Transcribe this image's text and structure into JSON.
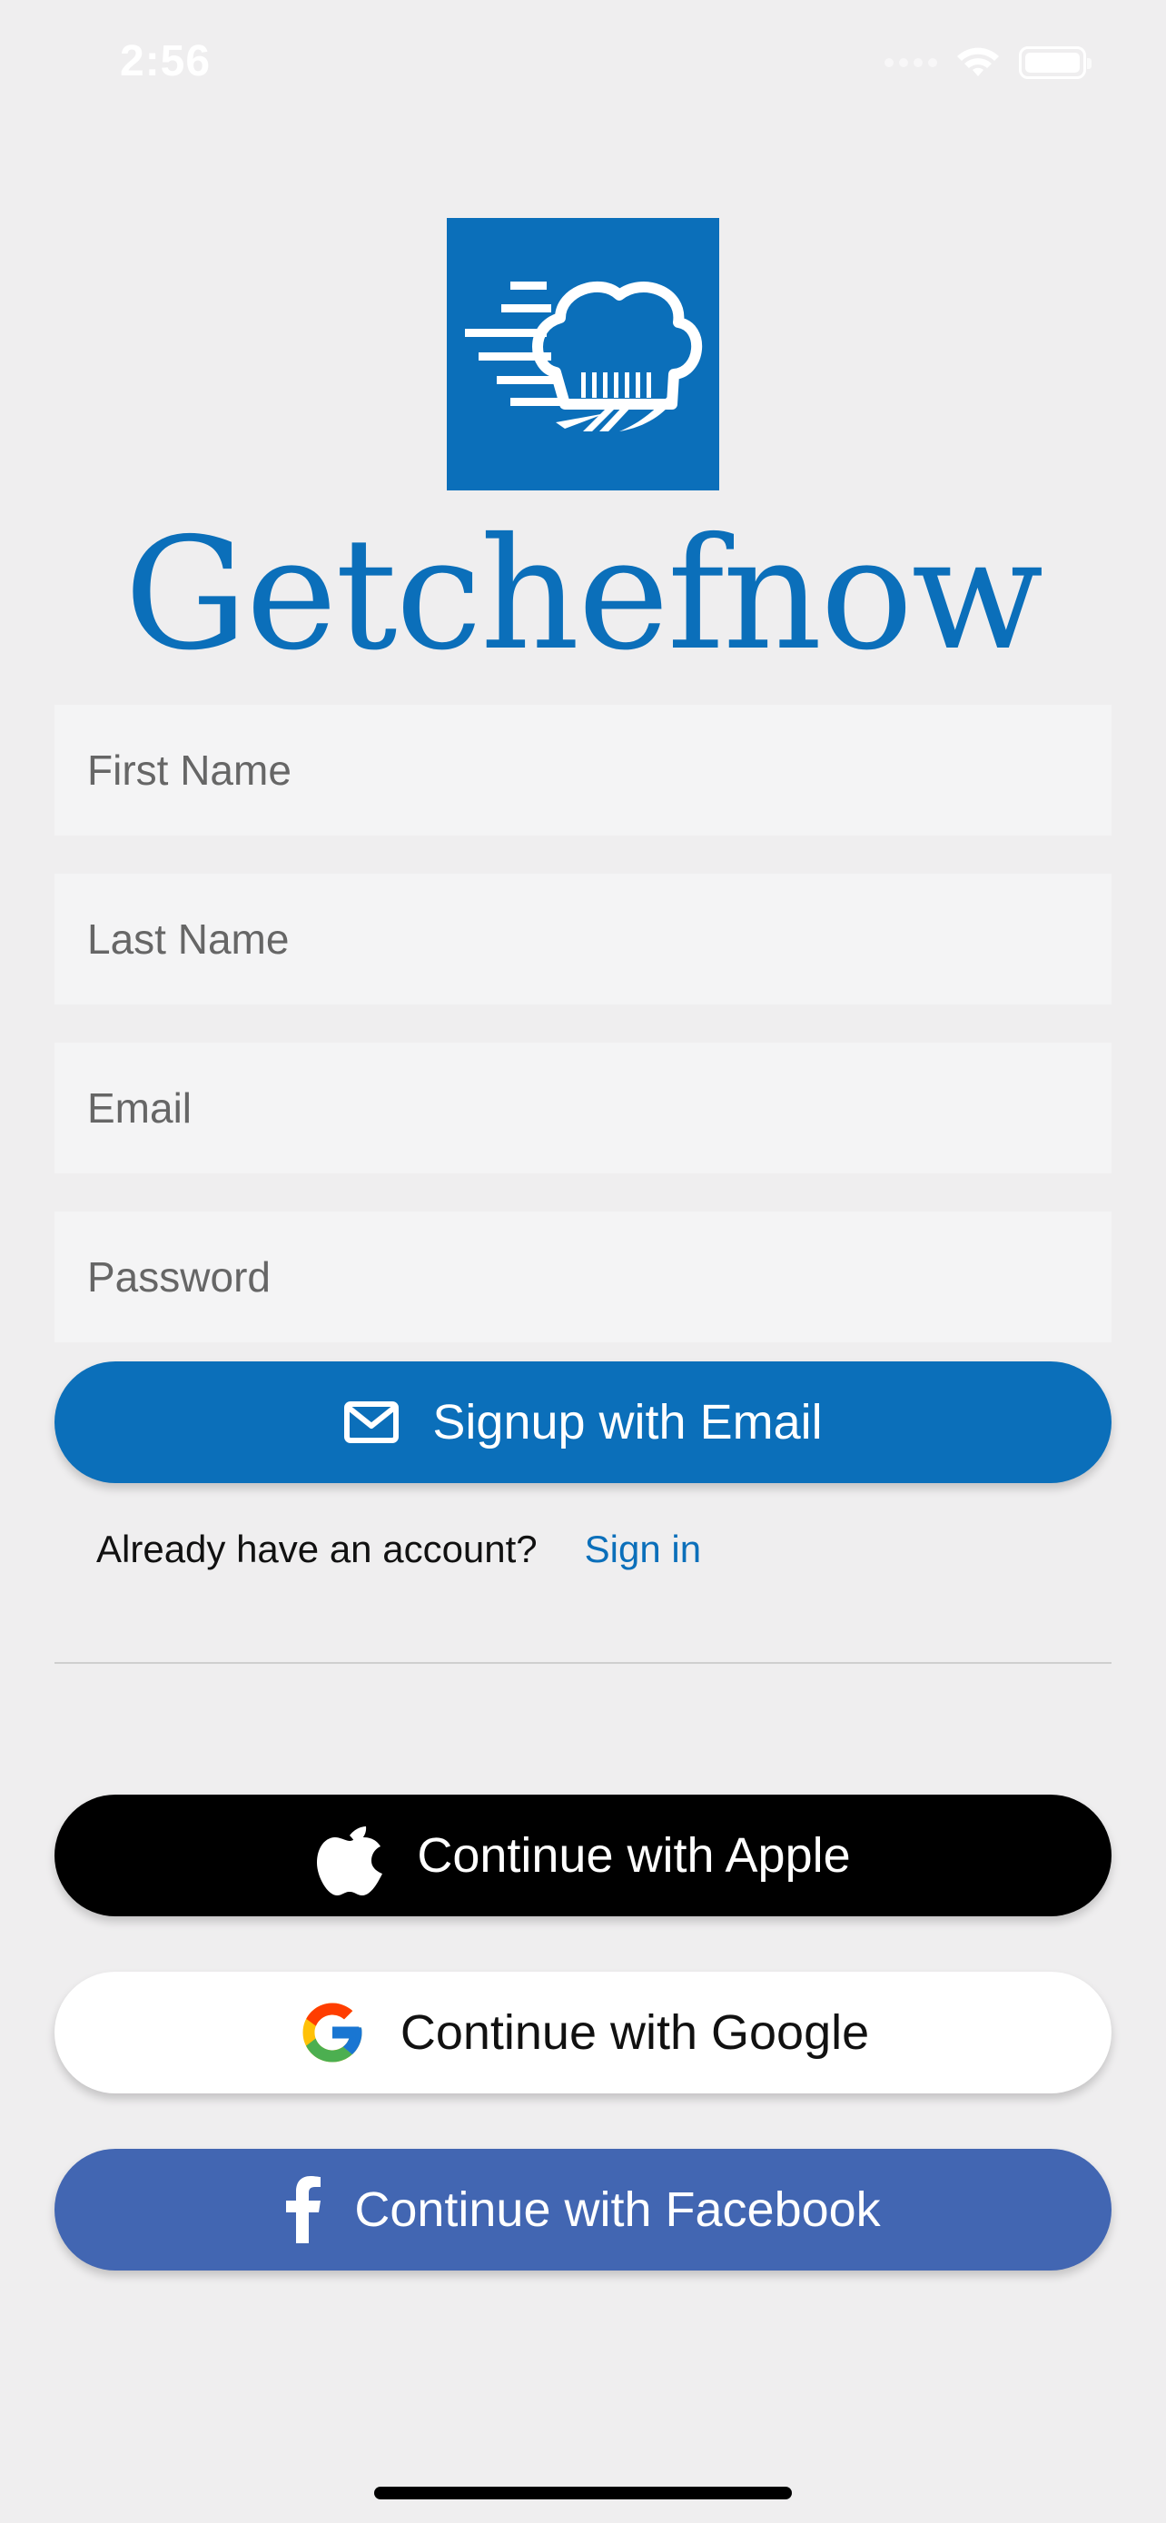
{
  "status_bar": {
    "time": "2:56"
  },
  "brand": {
    "name": "Getchefnow"
  },
  "form": {
    "first_name_placeholder": "First Name",
    "last_name_placeholder": "Last Name",
    "email_placeholder": "Email",
    "password_placeholder": "Password"
  },
  "buttons": {
    "signup_email": "Signup with Email",
    "apple": "Continue with Apple",
    "google": "Continue with Google",
    "facebook": "Continue with Facebook"
  },
  "account": {
    "prompt": "Already have an account?",
    "signin": "Sign in"
  },
  "colors": {
    "brand_blue": "#0b6fba",
    "facebook_blue": "#4266b2",
    "background": "#efeeef"
  },
  "icons": {
    "logo": "chef-hat-logo-icon",
    "email": "mail-icon",
    "apple": "apple-icon",
    "google": "google-icon",
    "facebook": "facebook-icon"
  }
}
